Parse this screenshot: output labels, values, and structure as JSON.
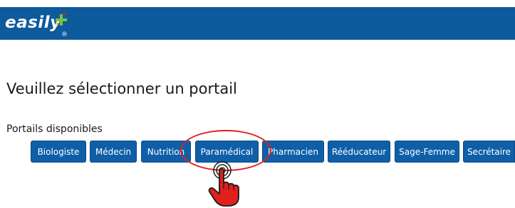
{
  "header": {
    "logo_text": "easily",
    "logo_registered": "®",
    "colors": {
      "bar": "#0d5a9c",
      "star_green": "#7ac143",
      "star_red": "#e0201b",
      "star_yellow": "#f2c200"
    }
  },
  "main": {
    "title": "Veuillez sélectionner un portail",
    "portals_label": "Portails disponibles",
    "portals": [
      {
        "label": "Biologiste"
      },
      {
        "label": "Médecin"
      },
      {
        "label": "Nutrition"
      },
      {
        "label": "Paramédical",
        "highlighted": true
      },
      {
        "label": "Pharmacien"
      },
      {
        "label": "Rééducateur"
      },
      {
        "label": "Sage-Femme"
      },
      {
        "label": "Secrétaire"
      }
    ],
    "button_color": "#0f5fa8"
  },
  "annotation": {
    "icons": [
      "highlight-circle",
      "tap-hand-icon"
    ],
    "color": "#e0201b"
  }
}
